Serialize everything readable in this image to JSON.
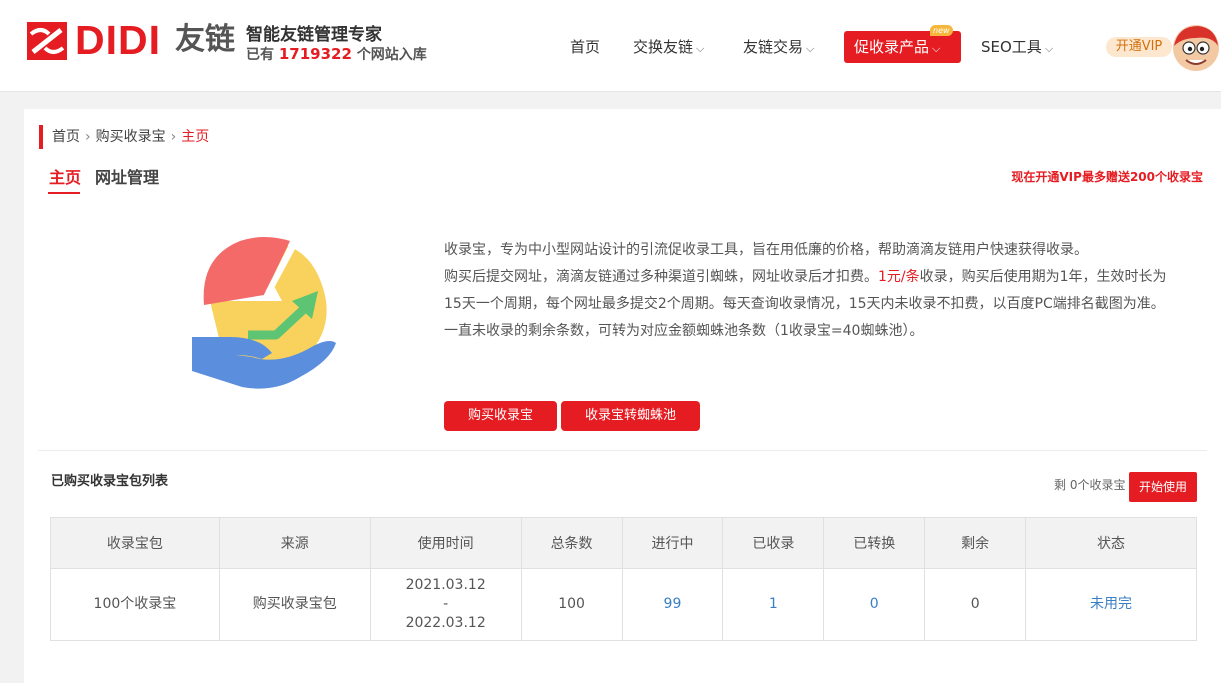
{
  "header": {
    "logo_text": "DIDI",
    "logo_cn": "友链",
    "slogan": "智能友链管理专家",
    "stats_prefix": "已有",
    "stats_count": "1719322",
    "stats_suffix": "个网站入库",
    "nav": {
      "home": "首页",
      "exchange": "交换友链",
      "trade": "友链交易",
      "promo": "促收录产品",
      "promo_badge": "new",
      "seo": "SEO工具"
    },
    "vip_button": "开通VIP",
    "chevron": "⌵"
  },
  "breadcrumb": {
    "items": [
      "首页",
      "购买收录宝",
      "主页"
    ],
    "separator": "›"
  },
  "tabs": {
    "home": "主页",
    "urls": "网址管理"
  },
  "promo_text": "现在开通VIP最多赠送200个收录宝",
  "description": {
    "line1": "收录宝，专为中小型网站设计的引流促收录工具，旨在用低廉的价格，帮助滴滴友链用户快速获得收录。",
    "line2_pre": "购买后提交网址，滴滴友链通过多种渠道引蜘蛛，网址收录后才扣费。",
    "price": "1元/条",
    "line2_post": "收录，购买后使用期为1年，生效时长为15天一个周期，每个网址最多提交2个周期。每天查询收录情况，15天内未收录不扣费，以百度PC端排名截图为准。",
    "line3": "一直未收录的剩余条数，可转为对应金额蜘蛛池条数（1收录宝=40蜘蛛池）。"
  },
  "buttons": {
    "buy": "购买收录宝",
    "convert": "收录宝转蜘蛛池",
    "start": "开始使用"
  },
  "list": {
    "title": "已购买收录宝包列表",
    "remain": "剩 0个收录宝",
    "columns": [
      "收录宝包",
      "来源",
      "使用时间",
      "总条数",
      "进行中",
      "已收录",
      "已转换",
      "剩余",
      "状态"
    ],
    "rows": [
      {
        "package": "100个收录宝",
        "source": "购买收录宝包",
        "time_start": "2021.03.12",
        "time_sep": "-",
        "time_end": "2022.03.12",
        "total": "100",
        "in_progress": "99",
        "indexed": "1",
        "converted": "0",
        "remaining": "0",
        "status": "未用完"
      }
    ]
  },
  "colors": {
    "brand_red": "#e51d23",
    "link_blue": "#3a7fc4",
    "vip_bg": "#fde8cf"
  }
}
